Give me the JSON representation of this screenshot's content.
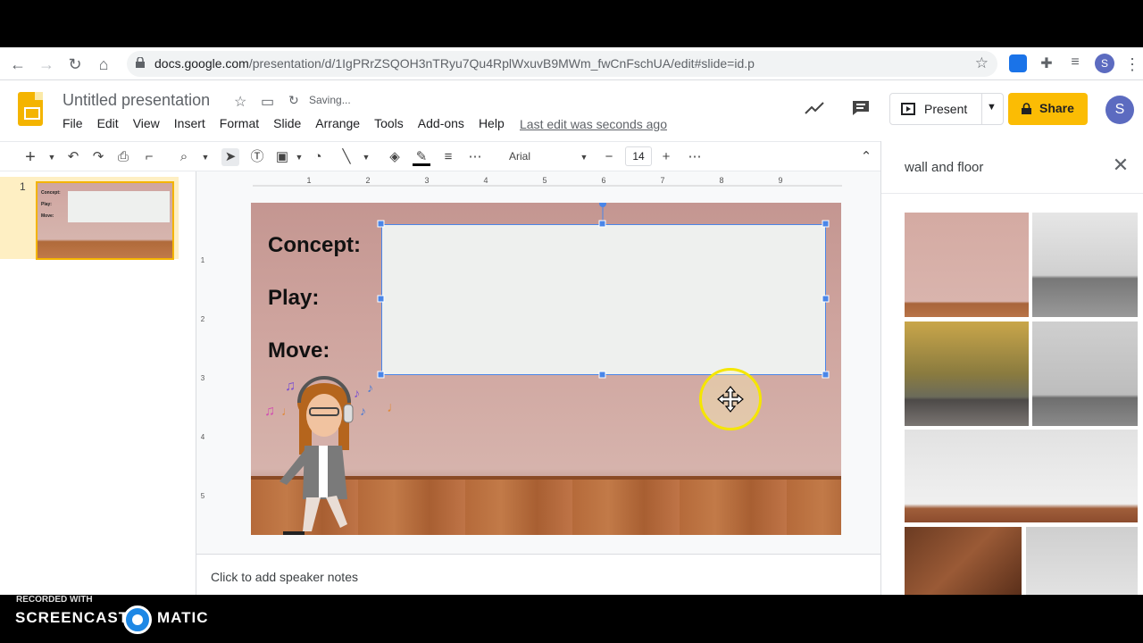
{
  "browser": {
    "url_host": "docs.google.com",
    "url_path": "/presentation/d/1IgPRrZSQOH3nTRyu7Qu4RplWxuvB9MWm_fwCnFschUA/edit#slide=id.p",
    "avatar_letter": "S"
  },
  "app": {
    "title": "Untitled presentation",
    "saving_status": "Saving...",
    "menu": [
      "File",
      "Edit",
      "View",
      "Insert",
      "Format",
      "Slide",
      "Arrange",
      "Tools",
      "Add-ons",
      "Help"
    ],
    "last_edit": "Last edit was seconds ago",
    "present_label": "Present",
    "share_label": "Share",
    "avatar_letter": "S",
    "brand_color": "#f4b400",
    "share_color": "#fbbc04"
  },
  "toolbar": {
    "font_name": "Arial",
    "font_size": "14",
    "ruler_h": [
      "1",
      "2",
      "3",
      "4",
      "5",
      "6",
      "7",
      "8",
      "9"
    ],
    "ruler_v": [
      "1",
      "2",
      "3",
      "4",
      "5"
    ]
  },
  "filmstrip": {
    "slide_number": "1",
    "thumb_labels": [
      "Concept:",
      "Play:",
      "Move:"
    ]
  },
  "slide": {
    "labels": [
      "Concept:",
      "Play:",
      "Move:"
    ],
    "selection_color": "#4a86e8"
  },
  "notes": {
    "placeholder": "Click to add speaker notes"
  },
  "image_search": {
    "query": "wall and floor"
  },
  "recorder": {
    "small_text": "RECORDED WITH",
    "brand_left": "SCREENCAST",
    "brand_right": "MATIC"
  }
}
